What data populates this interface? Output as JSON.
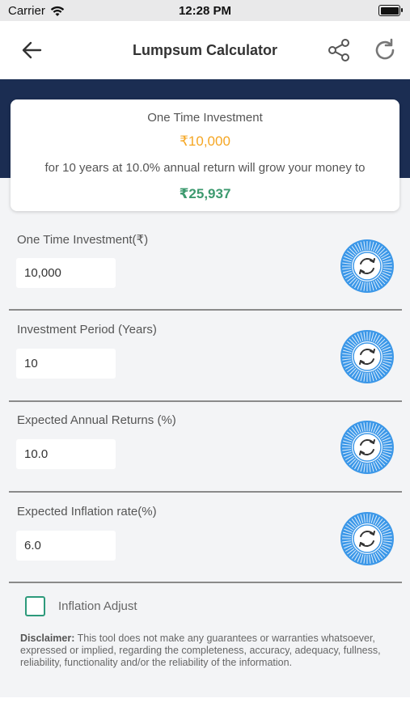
{
  "status_bar": {
    "carrier": "Carrier",
    "time": "12:28 PM"
  },
  "header": {
    "title": "Lumpsum Calculator"
  },
  "summary": {
    "title": "One Time Investment",
    "amount": "₹10,000",
    "description": "for 10 years at 10.0% annual return will grow your money to",
    "result": "₹25,937"
  },
  "fields": [
    {
      "label": "One Time Investment(₹)",
      "value": "10,000"
    },
    {
      "label": "Investment Period (Years)",
      "value": "10"
    },
    {
      "label": "Expected Annual Returns (%)",
      "value": "10.0"
    },
    {
      "label": "Expected Inflation rate(%)",
      "value": "6.0"
    }
  ],
  "inflation_adjust": {
    "label": "Inflation Adjust",
    "checked": false
  },
  "disclaimer": {
    "heading": "Disclaimer:",
    "text": " This tool does not make any guarantees or warranties whatsoever, expressed or implied, regarding the completeness, accuracy, adequacy, fullness, reliability, functionality and/or the reliability of the information."
  },
  "colors": {
    "banner": "#1b2d52",
    "amount": "#f5a623",
    "result": "#3d9a6f",
    "dial": "#3b97e8",
    "checkbox": "#2d9a7b"
  },
  "icons": {
    "back": "arrow-left-icon",
    "share": "share-icon",
    "refresh": "refresh-icon",
    "dial": "rotary-dial-icon",
    "wifi": "wifi-icon",
    "battery": "battery-icon"
  }
}
